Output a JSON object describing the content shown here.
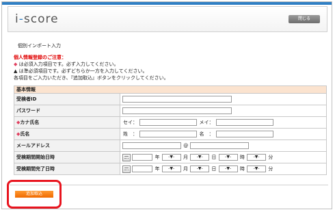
{
  "header": {
    "logo_text_a": "i",
    "logo_text_b": "-",
    "logo_text_c": "score",
    "close_label": "閉じる"
  },
  "page": {
    "title": "個別インポート入力"
  },
  "notice": {
    "heading": "個人情報登録のご注意：",
    "line1_mark": "◆",
    "line1_text": " は必須入力項目です。必ず入力してください。",
    "line2_mark": "▲",
    "line2_text": " は準必須項目です。必ずどちらか一方を入力してください。",
    "line3_text": "各項目をご入力いただき、『追加取込』ボタンをクリックしてください。"
  },
  "form": {
    "section_title": "基本情報",
    "rows": {
      "examinee_id": "受検者ID",
      "password": "パスワード",
      "kana_mark": "◆",
      "kana_name": "カナ氏名",
      "kana_sei": "セイ：",
      "kana_mei": "メイ：",
      "name_mark": "◆",
      "name": "氏名",
      "name_sei": "姓　：",
      "name_mei": "名　：",
      "email": "メールアドレス",
      "email_at": "@",
      "start": "受検期間開始日時",
      "end": "受検期間完了日時"
    },
    "date_units": {
      "year": "年",
      "month": "月",
      "day": "日",
      "hour": "時",
      "minute": "分"
    },
    "select_placeholder": "-▼-",
    "select_arrow": "▾"
  },
  "actions": {
    "add_label": "追加取込"
  },
  "colors": {
    "accent": "#2f7fc4",
    "section_bg": "#fbe3cf",
    "button": "#f07a10",
    "highlight": "#e8141e"
  }
}
